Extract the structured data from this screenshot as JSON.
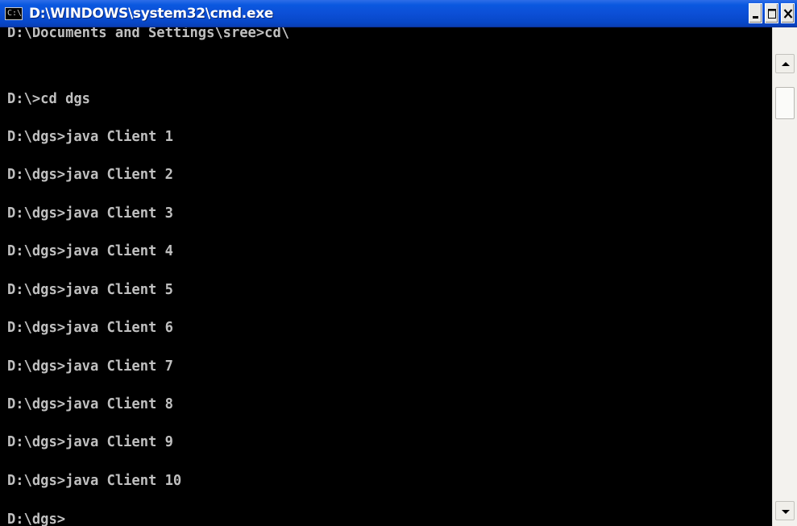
{
  "window": {
    "title": "D:\\WINDOWS\\system32\\cmd.exe",
    "icon": "cmd-console-icon",
    "icon_text": "C:\\"
  },
  "controls": {
    "minimize_icon": "minimize-icon",
    "maximize_icon": "maximize-icon",
    "close_icon": "close-icon"
  },
  "console": {
    "background": "#000000",
    "text_color": "#c0c0c0",
    "lines": [
      "D:\\Documents and Settings\\sree>cd\\",
      "D:\\>cd dgs",
      "D:\\dgs>java Client 1",
      "D:\\dgs>java Client 2",
      "D:\\dgs>java Client 3",
      "D:\\dgs>java Client 4",
      "D:\\dgs>java Client 5",
      "D:\\dgs>java Client 6",
      "D:\\dgs>java Client 7",
      "D:\\dgs>java Client 8",
      "D:\\dgs>java Client 9",
      "D:\\dgs>java Client 10",
      "D:\\dgs>"
    ]
  },
  "scrollbar": {
    "up_icon": "scroll-up-arrow-icon",
    "down_icon": "scroll-down-arrow-icon"
  },
  "colors": {
    "titlebar": "#0c4fd6",
    "title_text": "#ffffff"
  }
}
